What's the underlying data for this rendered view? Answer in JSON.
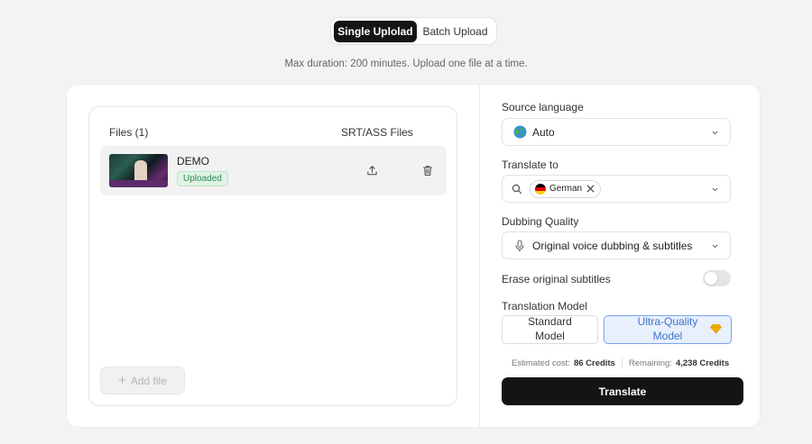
{
  "upload_mode": {
    "single_label": "Single Uplolad",
    "batch_label": "Batch Upload",
    "selected": "single"
  },
  "subtitle": "Max duration: 200 minutes. Upload one file at a time.",
  "files": {
    "header_files": "Files (1)",
    "header_srt": "SRT/ASS Files",
    "items": [
      {
        "name": "DEMO",
        "status": "Uploaded"
      }
    ],
    "add_file_label": "Add file"
  },
  "settings": {
    "source_language": {
      "label": "Source language",
      "value": "Auto",
      "icon": "globe-icon"
    },
    "translate_to": {
      "label": "Translate to",
      "chips": [
        "German"
      ],
      "icon": "search-icon"
    },
    "dubbing_quality": {
      "label": "Dubbing Quality",
      "value": "Original voice dubbing & subtitles",
      "icon": "microphone-icon"
    },
    "erase_subtitles": {
      "label": "Erase original subtitles",
      "enabled": false
    },
    "translation_model": {
      "label": "Translation Model",
      "options": [
        "Standard Model",
        "Ultra-Quality Model"
      ],
      "selected": "Ultra-Quality Model"
    }
  },
  "credits": {
    "estimated_label": "Estimated cost:",
    "estimated_value": "86 Credits",
    "remaining_label": "Remaining:",
    "remaining_value": "4,238 Credits"
  },
  "translate_button": "Translate",
  "colors": {
    "primary_dark": "#141414",
    "accent_blue": "#3c73c9",
    "success_green": "#2f8a57"
  }
}
